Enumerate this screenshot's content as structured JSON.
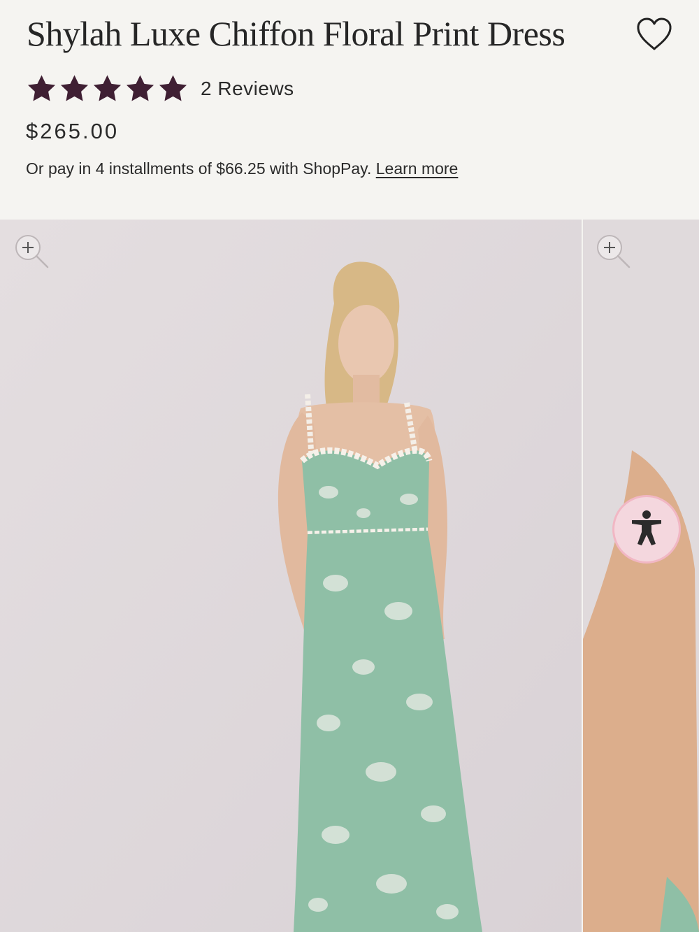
{
  "product": {
    "title": "Shylah Luxe Chiffon Floral Print Dress",
    "rating": 5,
    "rating_max": 5,
    "reviews_label": "2 Reviews",
    "price": "$265.00",
    "installments_text": "Or pay in 4 installments of $66.25 with ShopPay.",
    "learn_more_label": "Learn more"
  },
  "icons": {
    "wishlist": "heart-outline-icon",
    "star": "star-filled-icon",
    "zoom": "zoom-in-icon",
    "accessibility": "accessibility-person-icon"
  },
  "colors": {
    "star": "#3f1f33",
    "page_background": "#f5f4f1",
    "photo_background": "#e0dadc",
    "dress": "#8fbfa6",
    "accessibility_button": "#f4d7de"
  },
  "gallery": {
    "images": [
      {
        "label": "model wearing sage green floral print chiffon maxi dress with pearl straps"
      },
      {
        "label": "close-up of model shoulder and dress"
      }
    ]
  }
}
